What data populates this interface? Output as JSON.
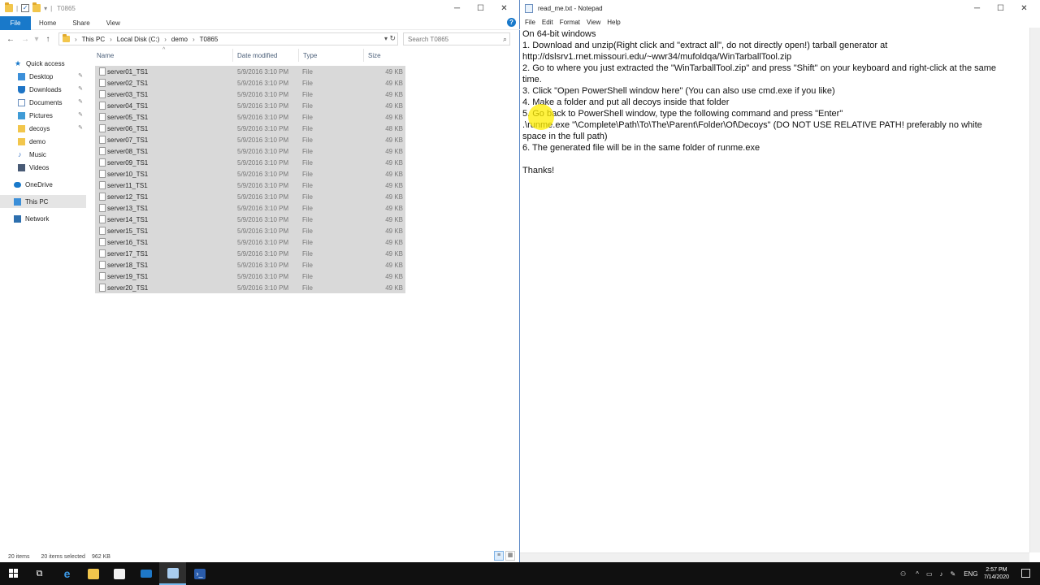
{
  "explorer": {
    "title": "T0865",
    "ribbon_tabs": [
      "File",
      "Home",
      "Share",
      "View"
    ],
    "address": [
      "This PC",
      "Local Disk (C:)",
      "demo",
      "T0865"
    ],
    "search_placeholder": "Search T0865",
    "nav": [
      {
        "label": "Quick access",
        "icon": "star-icon"
      },
      {
        "label": "Desktop",
        "icon": "desktop-icon",
        "pinned": true
      },
      {
        "label": "Downloads",
        "icon": "download-icon",
        "pinned": true
      },
      {
        "label": "Documents",
        "icon": "document-icon",
        "pinned": true
      },
      {
        "label": "Pictures",
        "icon": "pictures-icon",
        "pinned": true
      },
      {
        "label": "decoys",
        "icon": "folder-icon",
        "pinned": true
      },
      {
        "label": "demo",
        "icon": "folder-icon"
      },
      {
        "label": "Music",
        "icon": "music-icon"
      },
      {
        "label": "Videos",
        "icon": "video-icon"
      },
      {
        "label": "OneDrive",
        "icon": "cloud-icon"
      },
      {
        "label": "This PC",
        "icon": "computer-icon",
        "selected": true
      },
      {
        "label": "Network",
        "icon": "network-icon"
      }
    ],
    "columns": {
      "name": "Name",
      "date": "Date modified",
      "type": "Type",
      "size": "Size"
    },
    "files": [
      {
        "name": "server01_TS1",
        "date": "5/9/2016 3:10 PM",
        "type": "File",
        "size": "49 KB"
      },
      {
        "name": "server02_TS1",
        "date": "5/9/2016 3:10 PM",
        "type": "File",
        "size": "49 KB"
      },
      {
        "name": "server03_TS1",
        "date": "5/9/2016 3:10 PM",
        "type": "File",
        "size": "49 KB"
      },
      {
        "name": "server04_TS1",
        "date": "5/9/2016 3:10 PM",
        "type": "File",
        "size": "49 KB"
      },
      {
        "name": "server05_TS1",
        "date": "5/9/2016 3:10 PM",
        "type": "File",
        "size": "49 KB"
      },
      {
        "name": "server06_TS1",
        "date": "5/9/2016 3:10 PM",
        "type": "File",
        "size": "48 KB"
      },
      {
        "name": "server07_TS1",
        "date": "5/9/2016 3:10 PM",
        "type": "File",
        "size": "49 KB"
      },
      {
        "name": "server08_TS1",
        "date": "5/9/2016 3:10 PM",
        "type": "File",
        "size": "49 KB"
      },
      {
        "name": "server09_TS1",
        "date": "5/9/2016 3:10 PM",
        "type": "File",
        "size": "49 KB"
      },
      {
        "name": "server10_TS1",
        "date": "5/9/2016 3:10 PM",
        "type": "File",
        "size": "49 KB"
      },
      {
        "name": "server11_TS1",
        "date": "5/9/2016 3:10 PM",
        "type": "File",
        "size": "49 KB"
      },
      {
        "name": "server12_TS1",
        "date": "5/9/2016 3:10 PM",
        "type": "File",
        "size": "49 KB"
      },
      {
        "name": "server13_TS1",
        "date": "5/9/2016 3:10 PM",
        "type": "File",
        "size": "49 KB"
      },
      {
        "name": "server14_TS1",
        "date": "5/9/2016 3:10 PM",
        "type": "File",
        "size": "49 KB"
      },
      {
        "name": "server15_TS1",
        "date": "5/9/2016 3:10 PM",
        "type": "File",
        "size": "49 KB"
      },
      {
        "name": "server16_TS1",
        "date": "5/9/2016 3:10 PM",
        "type": "File",
        "size": "49 KB"
      },
      {
        "name": "server17_TS1",
        "date": "5/9/2016 3:10 PM",
        "type": "File",
        "size": "49 KB"
      },
      {
        "name": "server18_TS1",
        "date": "5/9/2016 3:10 PM",
        "type": "File",
        "size": "49 KB"
      },
      {
        "name": "server19_TS1",
        "date": "5/9/2016 3:10 PM",
        "type": "File",
        "size": "49 KB"
      },
      {
        "name": "server20_TS1",
        "date": "5/9/2016 3:10 PM",
        "type": "File",
        "size": "49 KB"
      }
    ],
    "status": {
      "count": "20 items",
      "selected": "20 items selected",
      "size": "962 KB"
    }
  },
  "notepad": {
    "title": "read_me.txt - Notepad",
    "menu": [
      "File",
      "Edit",
      "Format",
      "View",
      "Help"
    ],
    "lines": [
      "On 64-bit windows",
      "1. Download and unzip(Right click and \"extract all\", do not directly open!) tarball generator at",
      "http://dslsrv1.rnet.missouri.edu/~wwr34/mufoldqa/WinTarballTool.zip",
      "2. Go to where you just extracted the \"WinTarballTool.zip\" and press \"Shift\" on your keyboard and right-click at the same",
      "time.",
      "3. Click \"Open PowerShell window here\" (You can also use cmd.exe if you like)",
      "4. Make a folder and put all decoys inside that folder",
      "5. Go back to PowerShell window, type the following command and press \"Enter\"",
      " .\\runme.exe \"\\Complete\\Path\\To\\The\\Parent\\Folder\\Of\\Decoys\" (DO NOT USE RELATIVE PATH! preferably no white",
      "space in the full path)",
      "6. The generated file will be in the same folder of runme.exe",
      "",
      "Thanks!"
    ]
  },
  "taskbar": {
    "tray": {
      "language": "ENG",
      "time": "2:57 PM",
      "date": "7/14/2020"
    },
    "apps": [
      "windows-start",
      "task-view",
      "edge",
      "file-explorer",
      "store",
      "mail",
      "notepad",
      "powershell"
    ]
  }
}
